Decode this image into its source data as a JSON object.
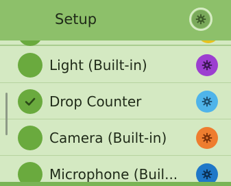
{
  "header": {
    "title": "Setup",
    "settings_icon": "gear-icon"
  },
  "sensors": [
    {
      "label": "Light (Built-in)",
      "checked": false,
      "icon": "gear-icon",
      "color": "#9c3fd0"
    },
    {
      "label": "Drop Counter",
      "checked": true,
      "icon": "gear-icon",
      "color": "#4fb4ea"
    },
    {
      "label": "Camera (Built-in)",
      "checked": false,
      "icon": "gear-icon",
      "color": "#ee7d2f"
    },
    {
      "label": "Microphone (Buil...",
      "checked": false,
      "icon": "gear-icon",
      "color": "#1f78c8"
    }
  ],
  "colors": {
    "header_bg": "#8dc06a",
    "list_bg": "#d4e9c2",
    "checkbox": "#6aaa3e"
  }
}
